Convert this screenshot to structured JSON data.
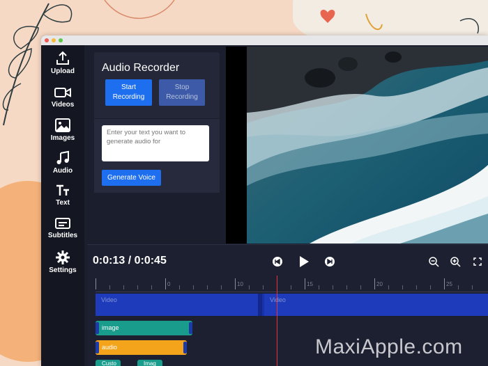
{
  "sidebar": {
    "items": [
      {
        "label": "Upload",
        "icon": "upload-icon"
      },
      {
        "label": "Videos",
        "icon": "video-camera-icon"
      },
      {
        "label": "Images",
        "icon": "image-icon"
      },
      {
        "label": "Audio",
        "icon": "music-note-icon"
      },
      {
        "label": "Text",
        "icon": "text-icon"
      },
      {
        "label": "Subtitles",
        "icon": "subtitles-icon"
      },
      {
        "label": "Settings",
        "icon": "gear-icon"
      }
    ]
  },
  "panel": {
    "title": "Audio Recorder",
    "start_line1": "Start",
    "start_line2": "Recording",
    "stop_line1": "Stop",
    "stop_line2": "Recording",
    "text_placeholder": "Enter your text you want to generate audio for",
    "generate_label": "Generate Voice"
  },
  "timeline": {
    "time_display": "0:0:13 / 0:0:45",
    "ruler_labels": [
      "0",
      "10",
      "15",
      "20",
      "25"
    ],
    "video_segment_1": "Video",
    "video_segment_2": "Video",
    "image_clip": "image",
    "audio_clip": "audio",
    "extra_clip_1": "Custo",
    "extra_clip_2": "Imag"
  },
  "watermark": "MaxiApple.com",
  "colors": {
    "accent_blue": "#1e6ff0",
    "image_track": "#1a9c8c",
    "audio_track": "#f3a41b",
    "playhead": "#e8323e",
    "video_track": "#1833a8"
  }
}
